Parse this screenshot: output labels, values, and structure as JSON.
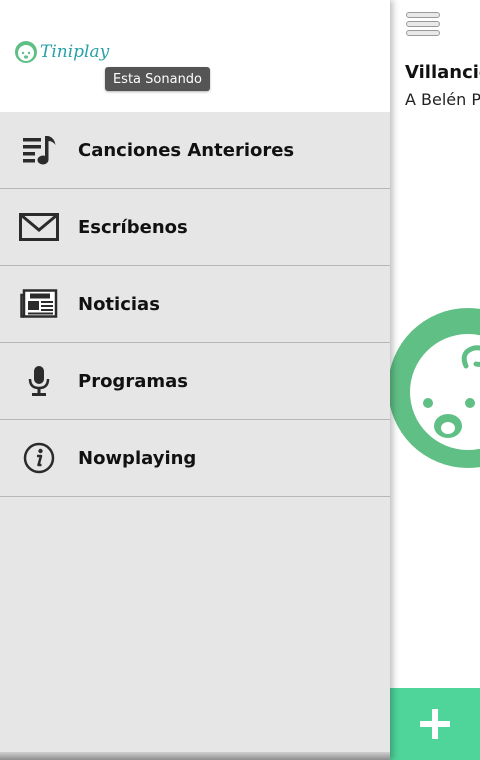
{
  "header": {
    "logo_text": "Tiniplay",
    "now_playing_button": "Esta Sonando"
  },
  "menu": [
    {
      "label": "Canciones Anteriores",
      "icon": "playlist-music-icon"
    },
    {
      "label": "Escríbenos",
      "icon": "envelope-icon"
    },
    {
      "label": "Noticias",
      "icon": "newspaper-icon"
    },
    {
      "label": "Programas",
      "icon": "microphone-icon"
    },
    {
      "label": "Nowplaying",
      "icon": "info-icon"
    }
  ],
  "now_playing": {
    "title": "Villancic",
    "artist": "A Belén Pa"
  },
  "colors": {
    "accent_green": "#4fd49a",
    "cover_green": "#5fbf85",
    "logo_teal": "#2aa0a8",
    "drawer_bg": "#e6e6e6",
    "button_dark": "#555555"
  },
  "fab": {
    "icon": "plus-icon"
  }
}
